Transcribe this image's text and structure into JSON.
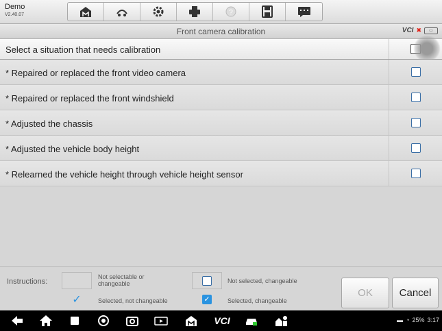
{
  "app": {
    "name": "Demo",
    "version": "V2.40.07"
  },
  "toolbar": {
    "buttons": [
      {
        "icon": "home-icon"
      },
      {
        "icon": "vehicle-swap-icon"
      },
      {
        "icon": "settings-gear-icon"
      },
      {
        "icon": "printer-icon"
      },
      {
        "icon": "help-icon"
      },
      {
        "icon": "save-icon"
      },
      {
        "icon": "data-log-icon"
      }
    ]
  },
  "titlebar": {
    "title": "Front camera calibration",
    "vci": "VCI"
  },
  "list": {
    "header": "Select a situation that needs calibration",
    "items": [
      {
        "label": "* Repaired or replaced the front video camera",
        "checked": false
      },
      {
        "label": "* Repaired or replaced the front windshield",
        "checked": false
      },
      {
        "label": "* Adjusted the chassis",
        "checked": false
      },
      {
        "label": "* Adjusted the vehicle body height",
        "checked": false
      },
      {
        "label": "* Relearned the vehicle height through vehicle height sensor",
        "checked": false
      }
    ]
  },
  "instructions": {
    "label": "Instructions:",
    "not_selectable": "Not selectable or changeable",
    "not_selected": "Not selected, changeable",
    "selected_not_changeable": "Selected, not changeable",
    "selected_changeable": "Selected, changeable",
    "ok": "OK",
    "cancel": "Cancel"
  },
  "status_bar": {
    "battery": "25%",
    "time": "3:17"
  },
  "colors": {
    "accent": "#2a93e0",
    "checkbox_border": "#3a6ea5"
  }
}
